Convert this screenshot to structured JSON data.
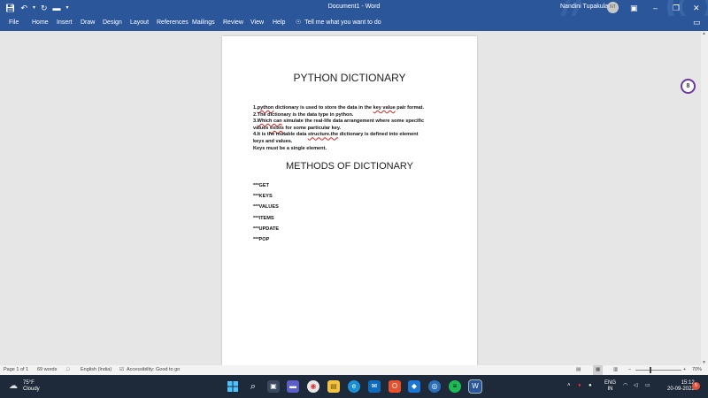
{
  "titlebar": {
    "doc_title": "Document1  -  Word",
    "user_name": "Nandini Tupakula",
    "avatar_initials": "NT",
    "accent": "#2b579a"
  },
  "menu": {
    "items": [
      "File",
      "Home",
      "Insert",
      "Draw",
      "Design",
      "Layout",
      "References",
      "Mailings",
      "Review",
      "View",
      "Help"
    ],
    "tell_me": "Tell me what you want to do"
  },
  "document": {
    "heading": "PYTHON DICTIONARY",
    "lines": [
      {
        "pre": "1.",
        "sq": "python",
        "post": " dictionary is used to store the data in the ",
        "sq2": "key value",
        "post2": " pair format."
      },
      {
        "pre": "2.The dictionary is the data type in python.",
        "sq": "",
        "post": "",
        "sq2": "",
        "post2": ""
      },
      {
        "pre": "3.",
        "sq": "Which can",
        "post": " simulate the real-life data arrangement where some specific",
        "sq2": "",
        "post2": ""
      },
      {
        "pre": "values ",
        "sq": "exists",
        "post": " for some particular key.",
        "sq2": "",
        "post2": ""
      },
      {
        "pre": "4.It is the mutable data ",
        "sq": "structure.the",
        "post": " dictionary is defined into element",
        "sq2": "",
        "post2": ""
      },
      {
        "pre": "keys and values.",
        "sq": "",
        "post": "",
        "sq2": "",
        "post2": ""
      },
      {
        "pre": "Keys must be a single element.",
        "sq": "",
        "post": "",
        "sq2": "",
        "post2": ""
      }
    ],
    "subheading": "METHODS OF DICTIONARY",
    "methods": [
      "***GET",
      "***KEYS",
      "***VALUES",
      "***ITEMS",
      "***UPDATE",
      "***POP"
    ],
    "comment_count": "8"
  },
  "statusbar": {
    "page": "Page 1 of 1",
    "words": "69 words",
    "language": "English (India)",
    "accessibility": "Accessibility: Good to go",
    "zoom": "70%"
  },
  "taskbar": {
    "temp": "75°F",
    "condition": "Cloudy",
    "lang_top": "ENG",
    "lang_bottom": "IN",
    "time": "15:12",
    "date": "20-09-2022",
    "notifications": "5"
  }
}
